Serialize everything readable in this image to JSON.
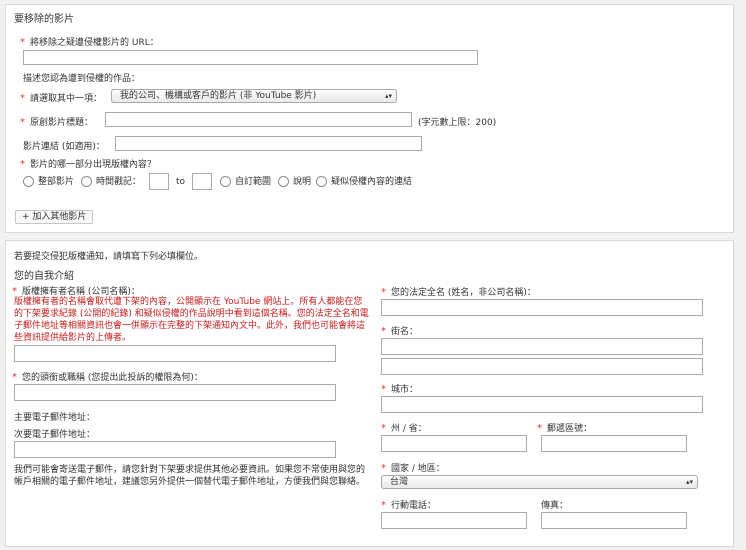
{
  "section1": {
    "title": "要移除的影片",
    "url_label": "將移除之疑遭侵權影片的 URL：",
    "describe_label": "描述您認為遭到侵權的作品：",
    "choose_label": "請選取其中一項：",
    "choose_value": "我的公司、機構或客戶的影片 (非 YouTube 影片)",
    "orig_title_label": "原創影片標題：",
    "char_limit": "(字元數上限：200)",
    "video_link_label": "影片連結 (如適用)：",
    "which_part_label": "影片的哪一部分出現版權內容？",
    "opt_entire": "整部影片",
    "opt_timestamp": "時間戳記：",
    "to_label": "to",
    "opt_custom": "自訂範圍",
    "opt_describe": "說明",
    "opt_link": "疑似侵權內容的連結",
    "add_more": "+ 加入其他影片"
  },
  "section2": {
    "intro": "若要提交侵犯版權通知，請填寫下列必填欄位。",
    "heading": "您的自我介紹",
    "owner_label": "版權擁有者名稱 (公司名稱)：",
    "owner_note": "版權擁有者的名稱會取代遭下架的內容，公開顯示在 YouTube 網站上。所有人都能在您的下架要求紀錄 (公開的紀錄) 和疑似侵權的作品說明中看到這個名稱。您的法定全名和電子郵件地址等相關資訊也會一併顯示在完整的下架通知內文中。此外，我們也可能會將這些資訊提供給影片的上傳者。",
    "position_label": "您的頭銜或職稱 (您提出此投訴的權限為何)：",
    "primary_email_label": "主要電子郵件地址：",
    "secondary_email_label": "次要電子郵件地址：",
    "email_note": "我們可能會寄送電子郵件，請您針對下架要求提供其他必要資訊。如果您不常使用與您的帳戶相關的電子郵件地址，建議您另外提供一個替代電子郵件地址，方便我們與您聯絡。",
    "legal_name_label": "您的法定全名 (姓名，非公司名稱)：",
    "street_label": "街名：",
    "city_label": "城市：",
    "state_label": "州 / 省：",
    "zip_label": "郵遞區號：",
    "country_label": "國家 / 地區：",
    "country_value": "台灣",
    "mobile_label": "行動電話：",
    "fax_label": "傳真："
  }
}
